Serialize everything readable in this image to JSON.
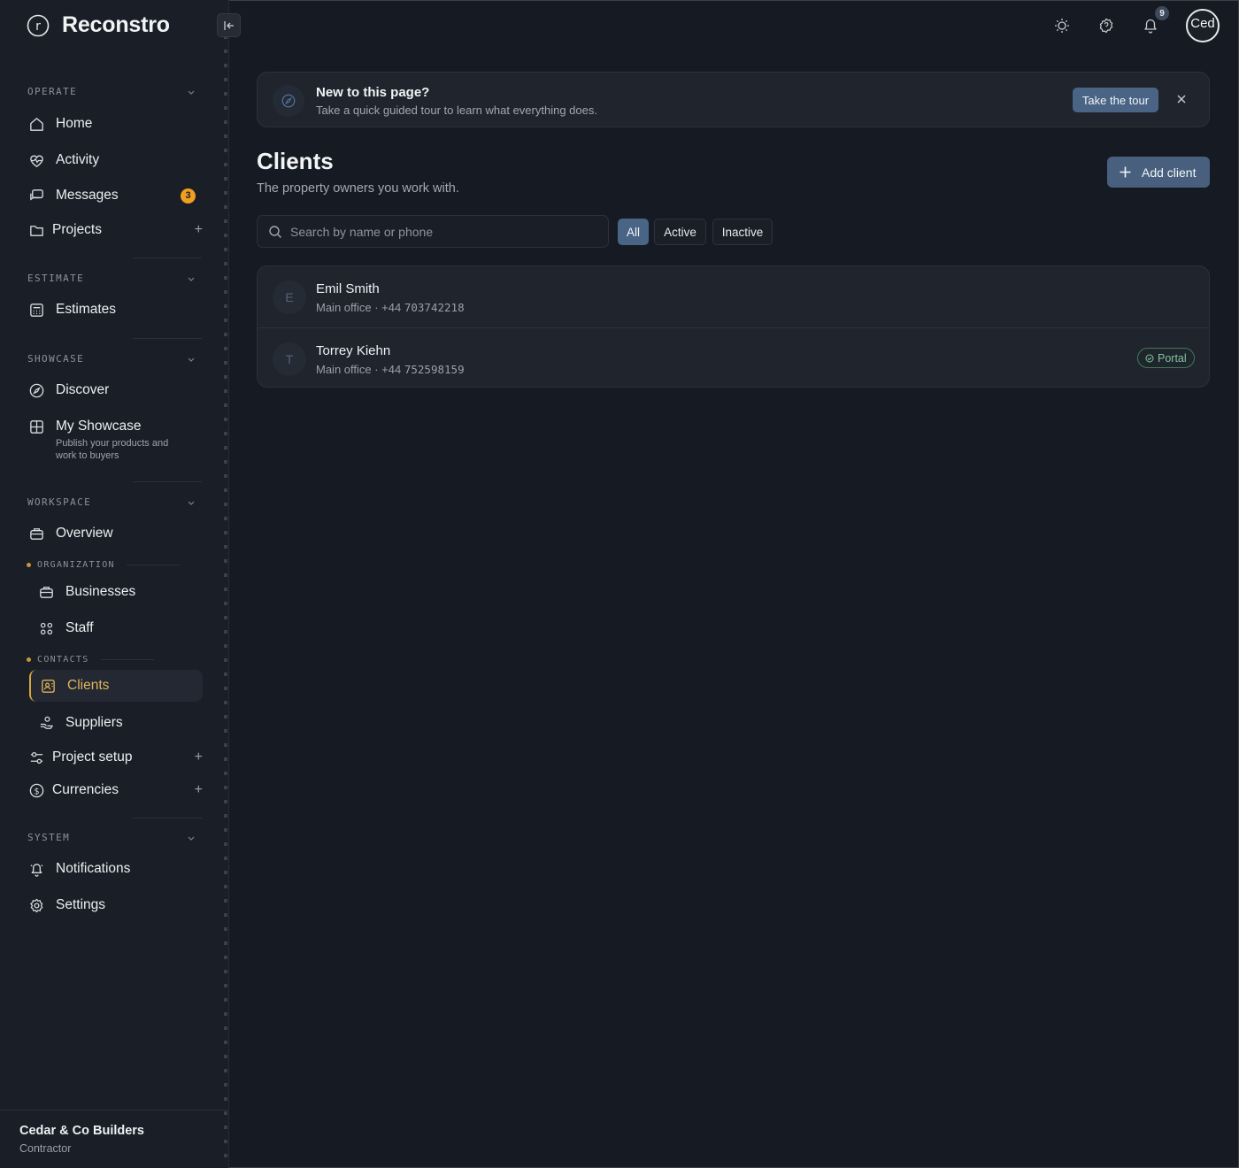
{
  "brand": {
    "name": "Reconstro",
    "logo_letter": "r"
  },
  "sidebar": {
    "sections": {
      "operate": "OPERATE",
      "estimate": "ESTIMATE",
      "showcase": "SHOWCASE",
      "workspace": "WORKSPACE",
      "system": "SYSTEM"
    },
    "subsections": {
      "organization": "ORGANIZATION",
      "contacts": "CONTACTS"
    },
    "items": {
      "home": "Home",
      "activity": "Activity",
      "messages": "Messages",
      "messages_badge": "3",
      "projects": "Projects",
      "estimates": "Estimates",
      "discover": "Discover",
      "my_showcase": "My Showcase",
      "my_showcase_desc": "Publish your products and work to buyers",
      "overview": "Overview",
      "businesses": "Businesses",
      "staff": "Staff",
      "clients": "Clients",
      "suppliers": "Suppliers",
      "project_setup": "Project setup",
      "currencies": "Currencies",
      "notifications": "Notifications",
      "settings": "Settings"
    },
    "plus_glyph": "+",
    "footer": {
      "org": "Cedar & Co Builders",
      "role": "Contractor"
    }
  },
  "topbar": {
    "notif_count": "9",
    "avatar_text": "Ced"
  },
  "tour": {
    "title": "New to this page?",
    "subtitle": "Take a quick guided tour to learn what everything does.",
    "button": "Take the tour"
  },
  "page": {
    "title": "Clients",
    "subtitle": "The property owners you work with.",
    "add_button": "Add client"
  },
  "search": {
    "placeholder": "Search by name or phone",
    "value": ""
  },
  "filters": {
    "all": "All",
    "active": "Active",
    "inactive": "Inactive",
    "selected": "All"
  },
  "clients": [
    {
      "initial": "E",
      "name": "Emil Smith",
      "office": "Main office · +44",
      "phone": "703742218",
      "portal": ""
    },
    {
      "initial": "T",
      "name": "Torrey Kiehn",
      "office": "Main office · +44",
      "phone": "752598159",
      "portal": "Portal"
    }
  ],
  "colors": {
    "accent": "#4a6485",
    "active_nav": "#e0b45a",
    "badge": "#f0a020",
    "portal": "#7ec79b"
  }
}
